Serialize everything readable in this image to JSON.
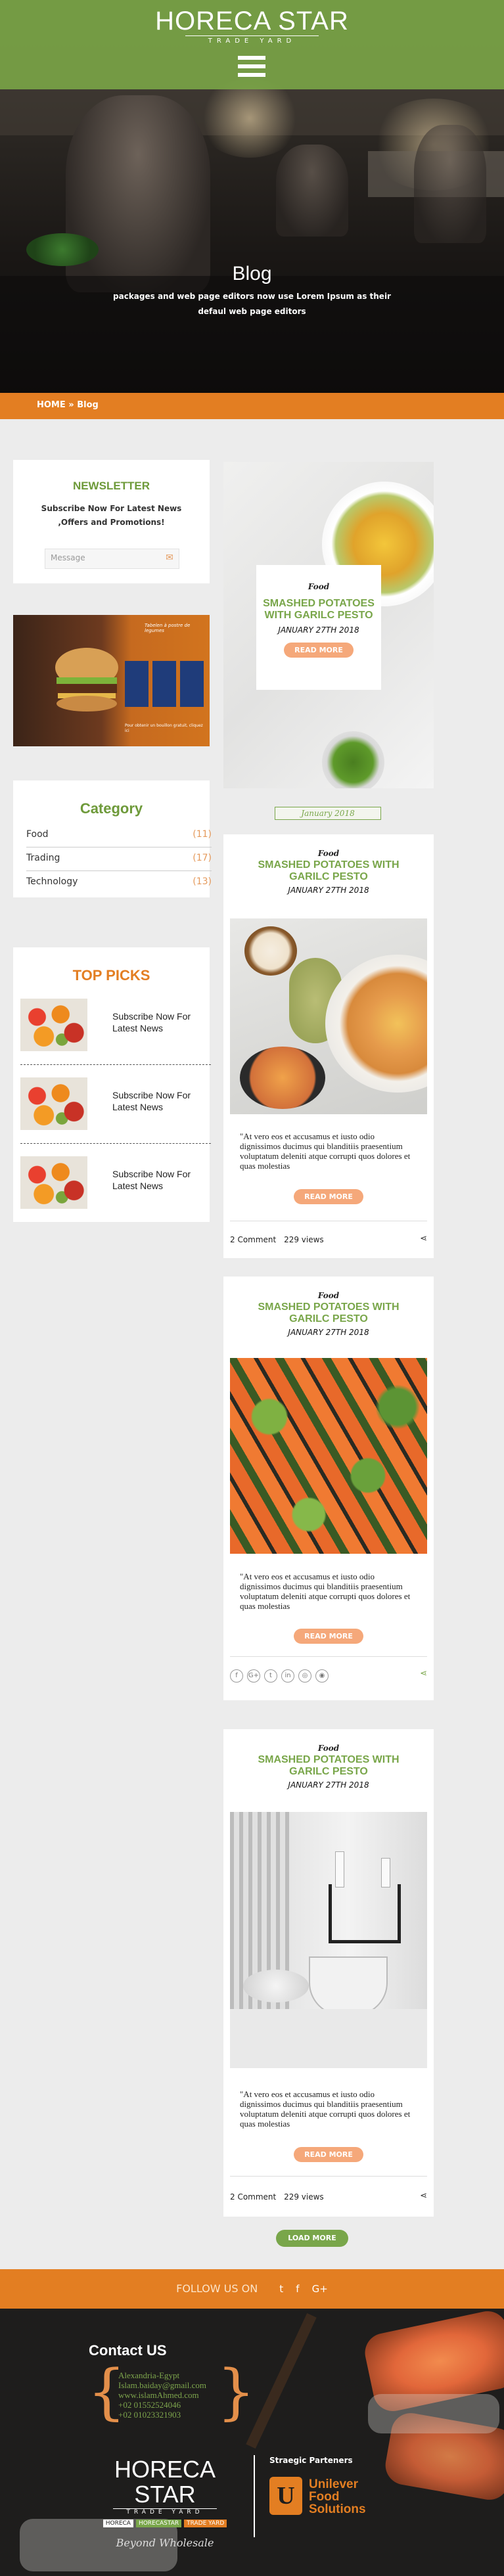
{
  "header": {
    "logo_main": "HORECA STAR",
    "logo_sub": "TRADE YARD",
    "menu_icon": "hamburger-icon",
    "hero_title": "Blog",
    "hero_subtitle": "packages and web page editors now use Lorem Ipsum as their defaul web page editors"
  },
  "breadcrumb": {
    "home": "HOME",
    "separator": "»",
    "current": "Blog"
  },
  "sidebar": {
    "newsletter": {
      "title": "NEWSLETTER",
      "text": "Subscribe Now For Latest News ,Offers and Promotions!",
      "input_placeholder": "Message",
      "submit_icon": "envelope-icon"
    },
    "promo": {
      "caption_top": "Tabelen à postre de legumes",
      "caption_bottom": "Pour obtenir un bouillon gratuit, cliquez ici"
    },
    "category": {
      "title": "Category",
      "items": [
        {
          "label": "Food",
          "count": "(11)"
        },
        {
          "label": "Trading",
          "count": "(17)"
        },
        {
          "label": "Technology",
          "count": "(13)"
        }
      ]
    },
    "top_picks": {
      "title": "TOP PICKS",
      "items": [
        {
          "text": "Subscribe Now For Latest News"
        },
        {
          "text": "Subscribe Now For Latest News"
        },
        {
          "text": "Subscribe Now For Latest News"
        }
      ]
    }
  },
  "featured": {
    "tag": "Food",
    "title": "SMASHED POTATOES WITH GARILC PESTO",
    "date": "JANUARY 27TH 2018",
    "button": "READ MORE"
  },
  "date_badge": "January 2018",
  "posts": [
    {
      "tag": "Food",
      "title": "SMASHED POTATOES WITH GARILC PESTO",
      "date": "JANUARY 27TH 2018",
      "excerpt": "\"At vero eos et accusamus et iusto odio dignissimos ducimus qui blanditiis praesentium voluptatum deleniti atque corrupti quos dolores et quas molestias",
      "button": "READ MORE",
      "comments": "2 Comment",
      "views": "229 views",
      "share_icon": "share-icon"
    },
    {
      "tag": "Food",
      "title": "SMASHED POTATOES WITH GARILC PESTO",
      "date": "JANUARY 27TH 2018",
      "excerpt": "\"At vero eos et accusamus et iusto odio dignissimos ducimus qui blanditiis praesentium voluptatum deleniti atque corrupti quos dolores et quas molestias",
      "button": "READ MORE",
      "social": [
        "f",
        "G+",
        "t",
        "in",
        "◎",
        "◉"
      ],
      "share_icon": "share-icon"
    },
    {
      "tag": "Food",
      "title": "SMASHED POTATOES WITH GARILC PESTO",
      "date": "JANUARY 27TH 2018",
      "excerpt": "\"At vero eos et accusamus et iusto odio dignissimos ducimus qui blanditiis praesentium voluptatum deleniti atque corrupti quos dolores et quas molestias",
      "button": "READ MORE",
      "comments": "2 Comment",
      "views": "229 views",
      "share_icon": "share-icon"
    }
  ],
  "load_more": "LOAD MORE",
  "follow": {
    "label": "FOLLOW US ON",
    "icons": [
      "twitter-icon",
      "facebook-icon",
      "google-plus-icon"
    ],
    "glyphs": [
      "t",
      "f",
      "G+"
    ]
  },
  "footer": {
    "contact_title": "Contact US",
    "lines": [
      "Alexandria-Egypt",
      "Islam.baiday@gmail.com",
      "www.islamAhmed.com",
      "+02 01552524046",
      "+02 01023321903"
    ],
    "logo_main": "HORECA STAR",
    "logo_sub": "TRADE YARD",
    "tags": [
      "HORECA",
      "HORECASTAR",
      "TRADE YARD"
    ],
    "slogan": "Beyond Wholesale",
    "partners_title": "Straegic Parteners",
    "partner": "Unilever Food Solutions",
    "partner_lines": [
      "Unilever",
      "Food",
      "Solutions"
    ],
    "colors": {
      "green": "#79a64a",
      "orange": "#e37e22"
    }
  }
}
